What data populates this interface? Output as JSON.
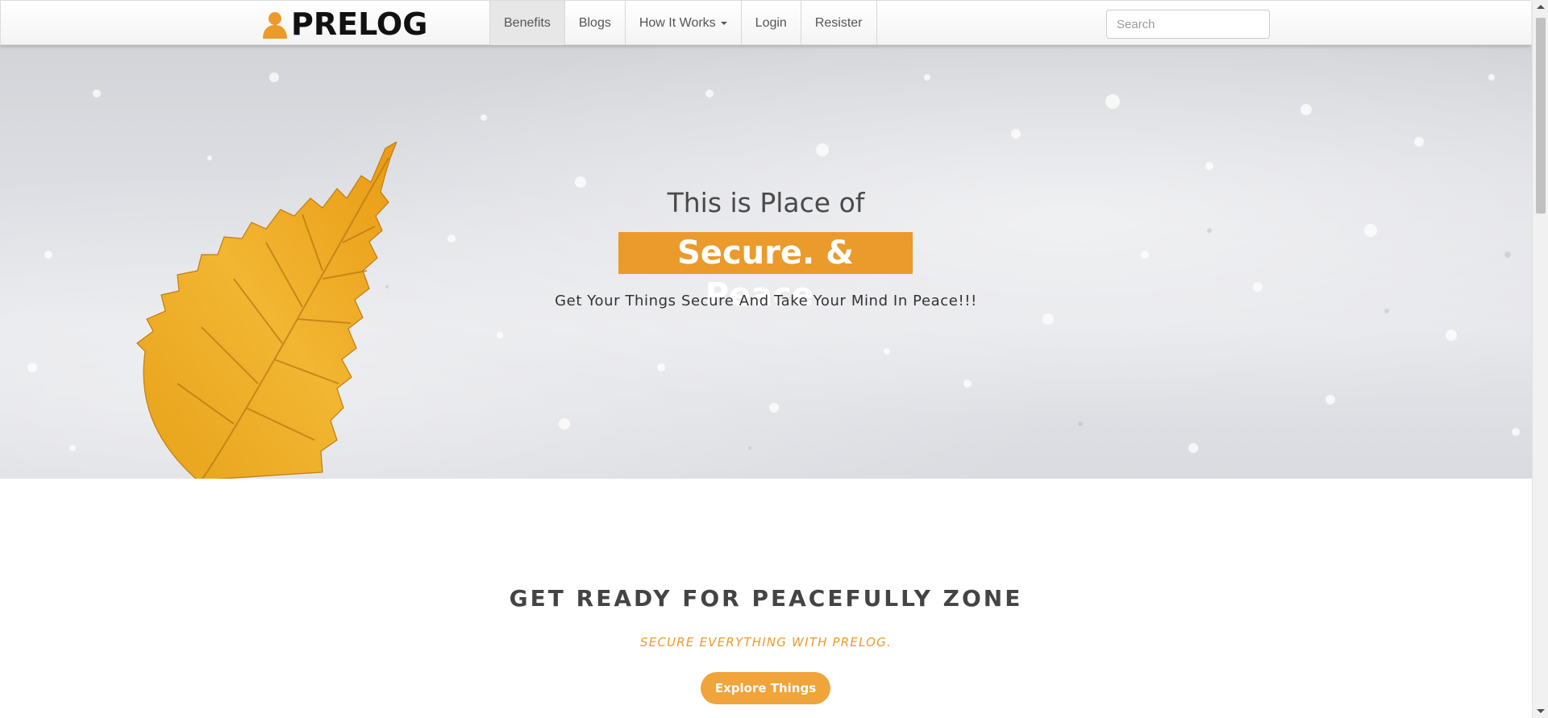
{
  "brand": {
    "name": "PRELOG",
    "icon": "user-icon",
    "color": "#eb9a2c"
  },
  "nav": {
    "items": [
      {
        "label": "Benefits",
        "active": true
      },
      {
        "label": "Blogs"
      },
      {
        "label": "How It Works",
        "dropdown": true
      },
      {
        "label": "Login"
      },
      {
        "label": "Resister"
      }
    ]
  },
  "search": {
    "placeholder": "Search",
    "value": ""
  },
  "hero": {
    "line1": "This is Place of",
    "highlight": "Secure. & Peace.",
    "tagline": "Get Your Things Secure And Take Your Mind In Peace!!!"
  },
  "section": {
    "title": "GET READY FOR PEACEFULLY ZONE",
    "subtitle": "SECURE EVERYTHING WITH PRELOG.",
    "button_label": "Explore Things"
  },
  "colors": {
    "accent": "#eb9a2c",
    "button": "#f0a43a",
    "text": "#444444"
  }
}
